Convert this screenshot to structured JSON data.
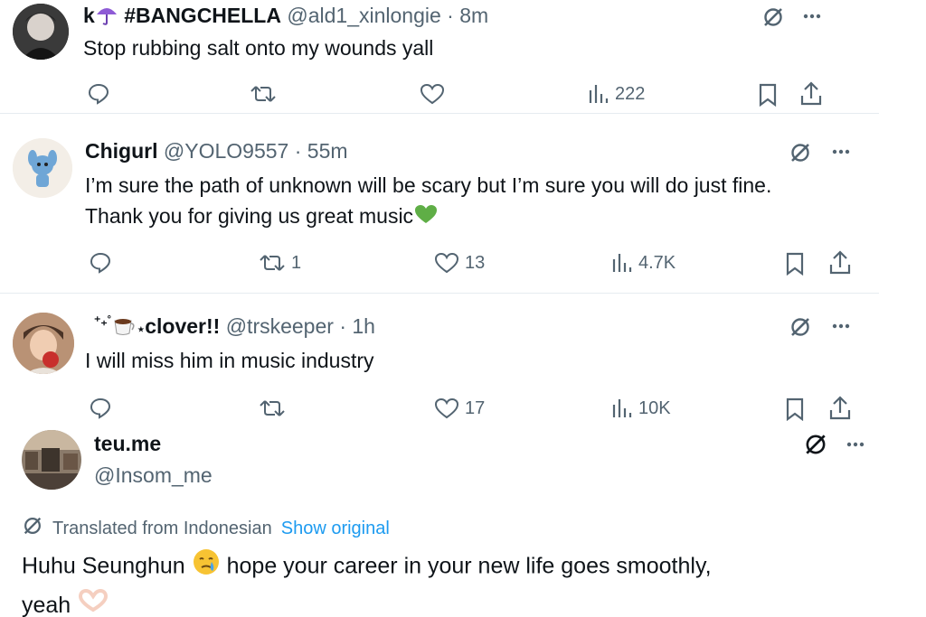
{
  "tweets": [
    {
      "name": "k☂️ #BANGCHELLA",
      "name_prefix": "k",
      "name_suffix": "#BANGCHELLA",
      "handle": "@ald1_xinlongie",
      "sep": "·",
      "time": "8m",
      "text": "Stop rubbing salt onto my wounds yall",
      "stats": {
        "reply": "",
        "retweet": "",
        "like": "",
        "views": "222"
      }
    },
    {
      "name": "Chigurl",
      "handle": "@YOLO9557",
      "sep": "·",
      "time": "55m",
      "text_line1": "I’m sure the path of unknown will be scary but I’m sure you will do just fine.",
      "text_line2": "Thank you for giving us great music",
      "stats": {
        "reply": "",
        "retweet": "1",
        "like": "13",
        "views": "4.7K"
      }
    },
    {
      "name": "clover!!",
      "name_prefix": "⁺₊˚",
      "handle": "@trskeeper",
      "sep": "·",
      "time": "1h",
      "text": "I will miss him in music industry",
      "stats": {
        "reply": "",
        "retweet": "",
        "like": "17",
        "views": "10K"
      }
    },
    {
      "name": "teu.me",
      "handle": "@Insom_me",
      "translated_label": "Translated from Indonesian",
      "show_original": "Show original",
      "text_line1_a": "Huhu Seunghun",
      "text_line1_b": "hope your career in your new life goes smoothly,",
      "text_line2": "yeah"
    }
  ],
  "icons": {
    "reply": "reply-icon",
    "retweet": "retweet-icon",
    "like": "like-icon",
    "views": "views-icon",
    "bookmark": "bookmark-icon",
    "share": "share-icon",
    "grok": "grok-icon",
    "more": "more-icon"
  },
  "colors": {
    "text": "#0f1419",
    "muted": "#536471",
    "link": "#1d9bf0",
    "heart_green": "#5fae46"
  }
}
